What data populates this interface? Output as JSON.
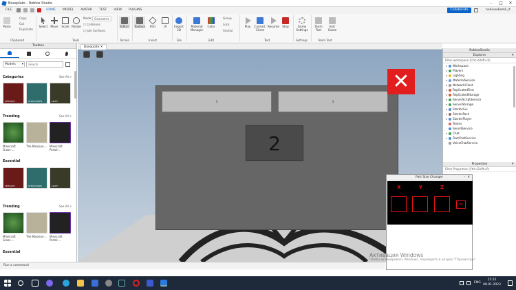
{
  "window": {
    "title": "Baseplate - Roblox Studio",
    "user": "hedivaebemli_it",
    "collaborate_label": "Collaborate"
  },
  "menubar": {
    "items": [
      "FILE",
      "HOME",
      "MODEL",
      "AVATAR",
      "TEST",
      "VIEW",
      "PLUGINS"
    ],
    "active": "HOME"
  },
  "ribbon": {
    "clipboard": {
      "label": "Clipboard",
      "paste": "Paste",
      "copy": "Copy",
      "cut": "Cut",
      "duplicate": "Duplicate"
    },
    "tools": {
      "label": "Tools",
      "select": "Select",
      "move": "Move",
      "scale": "Scale",
      "rotate": "Rotate",
      "mode_label": "Mode:",
      "mode_value": "Geometric",
      "collisions": "Collisions",
      "join_surfaces": "Join Surfaces"
    },
    "terrain": {
      "label": "Terrain",
      "editor": "Editor"
    },
    "insert": {
      "label": "Insert",
      "toolbox": "Toolbox",
      "part": "Part",
      "ui": "UI"
    },
    "file": {
      "label": "File",
      "import3d": "Import 3D"
    },
    "edit": {
      "label": "Edit",
      "material_manager": "Material Manager",
      "color": "Color",
      "group": "Group",
      "lock": "Lock",
      "anchor": "Anchor"
    },
    "test": {
      "label": "Test",
      "play": "Play",
      "current_client": "Current: Client",
      "resume": "Resume",
      "stop": "Stop"
    },
    "settings": {
      "label": "Settings",
      "game_settings": "Game Settings"
    },
    "team_test": {
      "label": "Team Test",
      "team_test": "Team Test",
      "exit_game": "Exit Game"
    }
  },
  "toolbox": {
    "title": "Toolbox",
    "dropdown": "Models",
    "search_placeholder": "Search",
    "sections": [
      {
        "title": "Categories",
        "see_all": "See All >",
        "items": [
          "VEHICLES",
          "STRUCTURES",
          "LIGHT"
        ]
      },
      {
        "title": "Trending",
        "see_all": "See All >",
        "items": [
          "Minecraft Grass-...",
          "The Mansion-...",
          "Minecraft Portal-..."
        ]
      },
      {
        "title": "Essential",
        "see_all": "",
        "items": [
          "VEHICLES",
          "STRUCTURES",
          "LIGHT"
        ]
      },
      {
        "title": "Trending",
        "see_all": "See All >",
        "items": [
          "Minecraft Grass-...",
          "The Mansion-...",
          "Minecraft Portal-..."
        ]
      },
      {
        "title": "Essential",
        "see_all": "",
        "items": []
      }
    ]
  },
  "viewport": {
    "tab": "Baseplate",
    "btn_left": "1",
    "btn_right": "1",
    "center_number": "2"
  },
  "explorer": {
    "header": "RobloxStudio",
    "title": "Explorer",
    "filter_placeholder": "Filter workspace (Ctrl+Shift+X)",
    "items": [
      "Workspace",
      "Players",
      "Lighting",
      "MaterialService",
      "NetworkClient",
      "ReplicatedFirst",
      "ReplicatedStorage",
      "ServerScriptService",
      "ServerStorage",
      "StarterGui",
      "StarterPack",
      "StarterPlayer",
      "Teams",
      "SoundService",
      "Chat",
      "TextChatService",
      "VoiceChatService"
    ]
  },
  "properties": {
    "title": "Properties",
    "filter_placeholder": "Filter Properties (Ctrl+Shift+P)"
  },
  "part_size_changer": {
    "title": "Part Size Changer",
    "labels": [
      "X",
      "Y",
      "Z"
    ],
    "ok_label": "OK"
  },
  "command_bar": {
    "placeholder": "Run a command"
  },
  "activation": {
    "title": "Активация Windows",
    "subtitle": "Чтобы активировать Windows, перейдите в раздел \"Параметры\"."
  },
  "taskbar": {
    "time": "15:22",
    "date": "08.01.2023",
    "lang": "ENG"
  },
  "colors": {
    "accent": "#0a63c9",
    "close_red": "#e11d1d",
    "viewport_sky": "#9fb3c9",
    "frame_gray": "#6a6a6a"
  }
}
